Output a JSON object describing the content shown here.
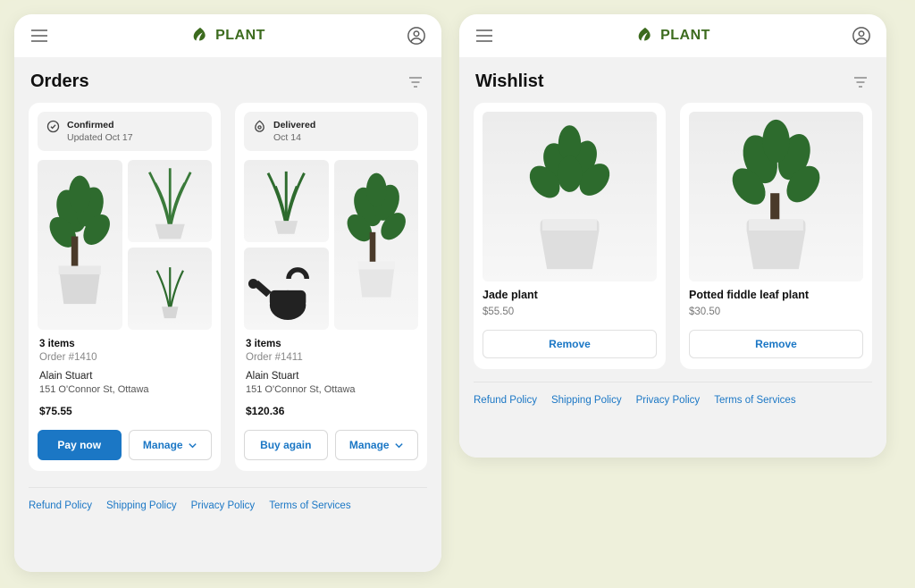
{
  "brand": {
    "name": "PLANT"
  },
  "orders_screen": {
    "title": "Orders",
    "orders": [
      {
        "status_label": "Confirmed",
        "status_sub": "Updated Oct 17",
        "items_count": "3 items",
        "order_id": "Order #1410",
        "customer": "Alain Stuart",
        "address": "151 O'Connor St, Ottawa",
        "total": "$75.55",
        "primary_btn": "Pay now",
        "secondary_btn": "Manage"
      },
      {
        "status_label": "Delivered",
        "status_sub": "Oct 14",
        "items_count": "3 items",
        "order_id": "Order #1411",
        "customer": "Alain Stuart",
        "address": "151 O'Connor St, Ottawa",
        "total": "$120.36",
        "primary_btn": "Buy again",
        "secondary_btn": "Manage"
      }
    ]
  },
  "wishlist_screen": {
    "title": "Wishlist",
    "items": [
      {
        "name": "Jade plant",
        "price": "$55.50",
        "action": "Remove"
      },
      {
        "name": "Potted fiddle leaf plant",
        "price": "$30.50",
        "action": "Remove"
      }
    ]
  },
  "footer": {
    "links": [
      "Refund Policy",
      "Shipping Policy",
      "Privacy Policy",
      "Terms of Services"
    ]
  }
}
